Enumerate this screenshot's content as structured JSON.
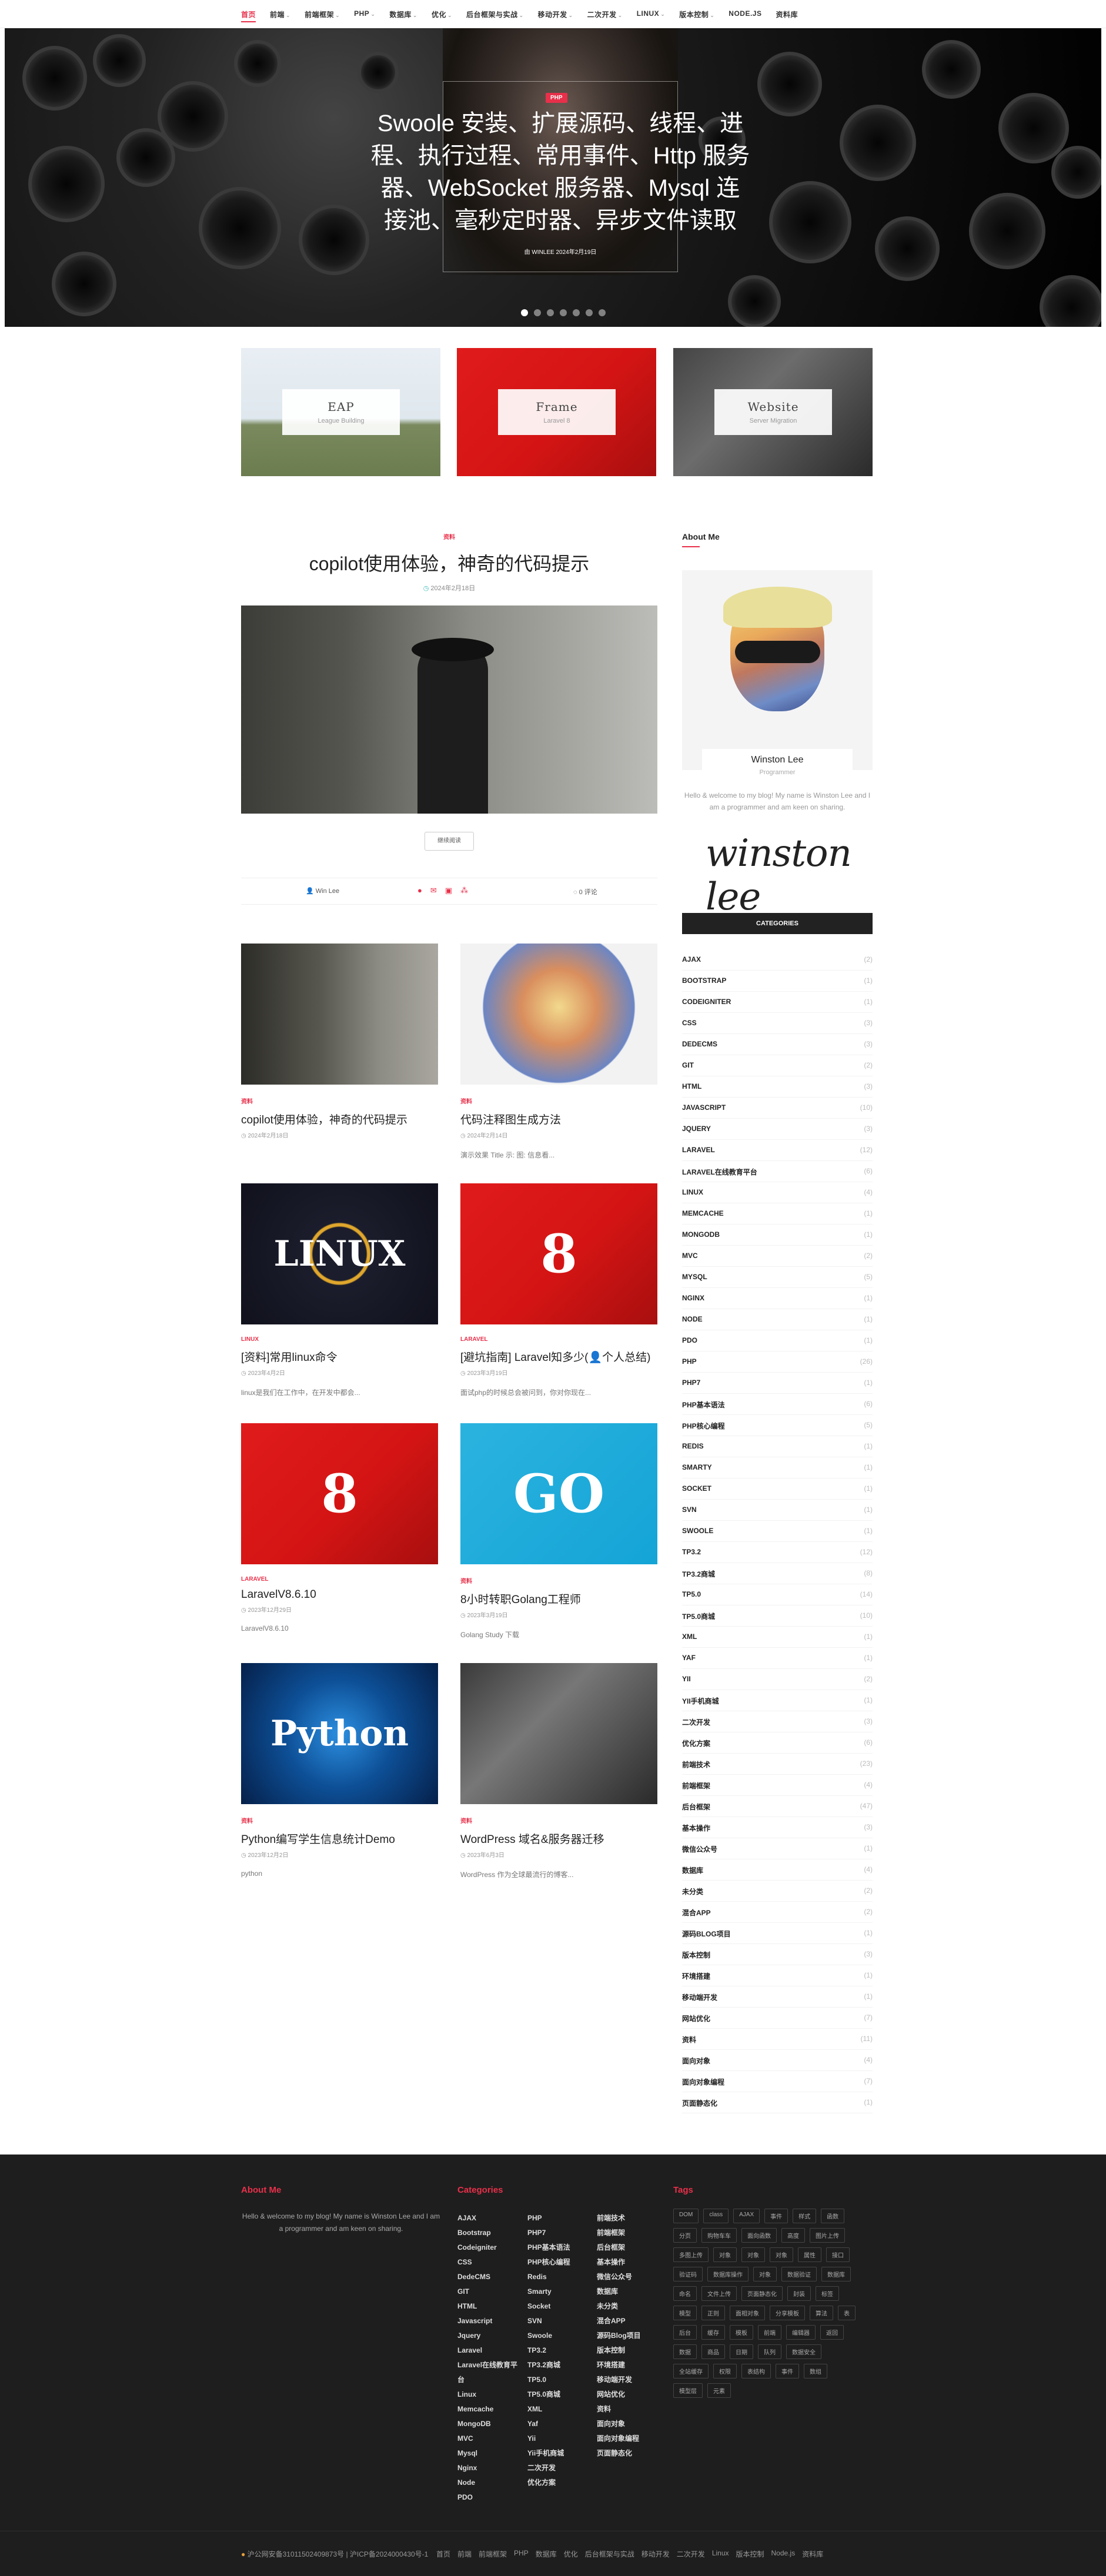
{
  "nav": {
    "items": [
      {
        "label": "首页",
        "caret": false
      },
      {
        "label": "前端",
        "caret": true
      },
      {
        "label": "前端框架",
        "caret": true
      },
      {
        "label": "PHP",
        "caret": true
      },
      {
        "label": "数据库",
        "caret": true
      },
      {
        "label": "优化",
        "caret": true
      },
      {
        "label": "后台框架与实战",
        "caret": true
      },
      {
        "label": "移动开发",
        "caret": true
      },
      {
        "label": "二次开发",
        "caret": true
      },
      {
        "label": "LINUX",
        "caret": true
      },
      {
        "label": "版本控制",
        "caret": true
      },
      {
        "label": "NODE.JS",
        "caret": false
      },
      {
        "label": "资料库",
        "caret": false
      }
    ]
  },
  "hero": {
    "category": "PHP",
    "title": "Swoole 安装、扩展源码、线程、进程、执行过程、常用事件、Http 服务器、WebSocket 服务器、Mysql 连接池、毫秒定时器、异步文件读取",
    "meta": "由 WINLEE  2024年2月19日",
    "slide_count": 7,
    "active_slide": 0
  },
  "featured": [
    {
      "title": "EAP",
      "subtitle": "League Building"
    },
    {
      "title": "Frame",
      "subtitle": "Laravel 8"
    },
    {
      "title": "Website",
      "subtitle": "Server Migration"
    }
  ],
  "main_post": {
    "category": "资料",
    "title": "copilot使用体验，神奇的代码提示",
    "date": "2024年2月18日",
    "read_more": "继续阅读",
    "author": "Win Lee",
    "comments": "0 评论"
  },
  "posts": [
    {
      "category": "资料",
      "title": "copilot使用体验，神奇的代码提示",
      "date": "2024年2月18日",
      "excerpt": ""
    },
    {
      "category": "资料",
      "title": "代码注释图生成方法",
      "date": "2024年2月14日",
      "excerpt": "演示效果 Title 示: 图: 信息看..."
    },
    {
      "category": "LINUX",
      "title": "[资料]常用linux命令",
      "date": "2023年4月2日",
      "excerpt": "linux是我们在工作中，在开发中都会..."
    },
    {
      "category": "LARAVEL",
      "title": "[避坑指南] Laravel知多少(👤个人总结)",
      "date": "2023年3月19日",
      "excerpt": "面试php的时候总会被问到，你对你现在..."
    },
    {
      "category": "LARAVEL",
      "title": "LaravelV8.6.10",
      "date": "2023年12月29日",
      "excerpt": "LaravelV8.6.10"
    },
    {
      "category": "资料",
      "title": "8小时转职Golang工程师",
      "date": "2023年3月19日",
      "excerpt": "Golang Study 下载"
    },
    {
      "category": "资料",
      "title": "Python编写学生信息统计Demo",
      "date": "2023年12月2日",
      "excerpt": "python"
    },
    {
      "category": "资料",
      "title": "WordPress 域名&服务器迁移",
      "date": "2023年6月3日",
      "excerpt": "WordPress 作为全球最流行的博客..."
    }
  ],
  "sidebar": {
    "about_heading": "About Me",
    "name": "Winston Lee",
    "role": "Programmer",
    "about_text": "Hello & welcome to my blog! My name is Winston Lee and I am a programmer and am keen on sharing.",
    "signature": "winston lee",
    "categories_heading": "CATEGORIES",
    "categories": [
      [
        "AJAX",
        "(2)"
      ],
      [
        "BOOTSTRAP",
        "(1)"
      ],
      [
        "CODEIGNITER",
        "(1)"
      ],
      [
        "CSS",
        "(3)"
      ],
      [
        "DEDECMS",
        "(3)"
      ],
      [
        "GIT",
        "(2)"
      ],
      [
        "HTML",
        "(3)"
      ],
      [
        "JAVASCRIPT",
        "(10)"
      ],
      [
        "JQUERY",
        "(3)"
      ],
      [
        "LARAVEL",
        "(12)"
      ],
      [
        "LARAVEL在线教育平台",
        "(6)"
      ],
      [
        "LINUX",
        "(4)"
      ],
      [
        "MEMCACHE",
        "(1)"
      ],
      [
        "MONGODB",
        "(1)"
      ],
      [
        "MVC",
        "(2)"
      ],
      [
        "MYSQL",
        "(5)"
      ],
      [
        "NGINX",
        "(1)"
      ],
      [
        "NODE",
        "(1)"
      ],
      [
        "PDO",
        "(1)"
      ],
      [
        "PHP",
        "(26)"
      ],
      [
        "PHP7",
        "(1)"
      ],
      [
        "PHP基本语法",
        "(6)"
      ],
      [
        "PHP核心编程",
        "(5)"
      ],
      [
        "REDIS",
        "(1)"
      ],
      [
        "SMARTY",
        "(1)"
      ],
      [
        "SOCKET",
        "(1)"
      ],
      [
        "SVN",
        "(1)"
      ],
      [
        "SWOOLE",
        "(1)"
      ],
      [
        "TP3.2",
        "(12)"
      ],
      [
        "TP3.2商城",
        "(8)"
      ],
      [
        "TP5.0",
        "(14)"
      ],
      [
        "TP5.0商城",
        "(10)"
      ],
      [
        "XML",
        "(1)"
      ],
      [
        "YAF",
        "(1)"
      ],
      [
        "YII",
        "(2)"
      ],
      [
        "YII手机商城",
        "(1)"
      ],
      [
        "二次开发",
        "(3)"
      ],
      [
        "优化方案",
        "(6)"
      ],
      [
        "前端技术",
        "(23)"
      ],
      [
        "前端框架",
        "(4)"
      ],
      [
        "后台框架",
        "(47)"
      ],
      [
        "基本操作",
        "(3)"
      ],
      [
        "微信公众号",
        "(1)"
      ],
      [
        "数据库",
        "(4)"
      ],
      [
        "未分类",
        "(2)"
      ],
      [
        "混合APP",
        "(2)"
      ],
      [
        "源码BLOG项目",
        "(1)"
      ],
      [
        "版本控制",
        "(3)"
      ],
      [
        "环境搭建",
        "(1)"
      ],
      [
        "移动端开发",
        "(1)"
      ],
      [
        "网站优化",
        "(7)"
      ],
      [
        "资料",
        "(11)"
      ],
      [
        "面向对象",
        "(4)"
      ],
      [
        "面向对象编程",
        "(7)"
      ],
      [
        "页面静态化",
        "(1)"
      ]
    ]
  },
  "footer": {
    "about_heading": "About Me",
    "about_text": "Hello & welcome to my blog! My name is Winston Lee and I am a programmer and am keen on sharing.",
    "categories_heading": "Categories",
    "col1": [
      "AJAX",
      "Bootstrap",
      "Codeigniter",
      "CSS",
      "DedeCMS",
      "GIT",
      "HTML",
      "Javascript",
      "Jquery",
      "Laravel",
      "Laravel在线教育平台",
      "Linux",
      "Memcache",
      "MongoDB",
      "MVC",
      "Mysql",
      "Nginx",
      "Node",
      "PDO"
    ],
    "col2": [
      "PHP",
      "PHP7",
      "PHP基本语法",
      "PHP核心编程",
      "Redis",
      "Smarty",
      "Socket",
      "SVN",
      "Swoole",
      "TP3.2",
      "TP3.2商城",
      "TP5.0",
      "TP5.0商城",
      "XML",
      "Yaf",
      "Yii",
      "Yii手机商城",
      "二次开发",
      "优化方案"
    ],
    "col3": [
      "前端技术",
      "前端框架",
      "后台框架",
      "基本操作",
      "微信公众号",
      "数据库",
      "未分类",
      "混合APP",
      "源码Blog项目",
      "版本控制",
      "环境搭建",
      "移动端开发",
      "网站优化",
      "资料",
      "面向对象",
      "面向对象编程",
      "页面静态化"
    ],
    "tags_heading": "Tags",
    "tags": [
      "DOM",
      "class",
      "AJAX",
      "事件",
      "样式",
      "函数",
      "分页",
      "购物车车",
      "面向函数",
      "高度",
      "图片上传",
      "多图上传",
      "对象",
      "对象",
      "对象",
      "属性",
      "接口",
      "验证码",
      "数据库操作",
      "对象",
      "数据验证",
      "数据库",
      "命名",
      "文件上传",
      "页面静态化",
      "封装",
      "标签",
      "模型",
      "正则",
      "面相对象",
      "分享模板",
      "算法",
      "表",
      "后台",
      "缓存",
      "模板",
      "前端",
      "编辑器",
      "返回",
      "数据",
      "商品",
      "日期",
      "队列",
      "数据安全",
      "全站缓存",
      "权限",
      "表结构",
      "事件",
      "数组",
      "模型层",
      "元素"
    ],
    "icp": "沪公网安备31011502409873号 | 沪ICP备2024000430号-1",
    "links": [
      "首页",
      "前端",
      "前端框架",
      "PHP",
      "数据库",
      "优化",
      "后台框架与实战",
      "移动开发",
      "二次开发",
      "Linux",
      "版本控制",
      "Node.js",
      "资料库"
    ]
  }
}
